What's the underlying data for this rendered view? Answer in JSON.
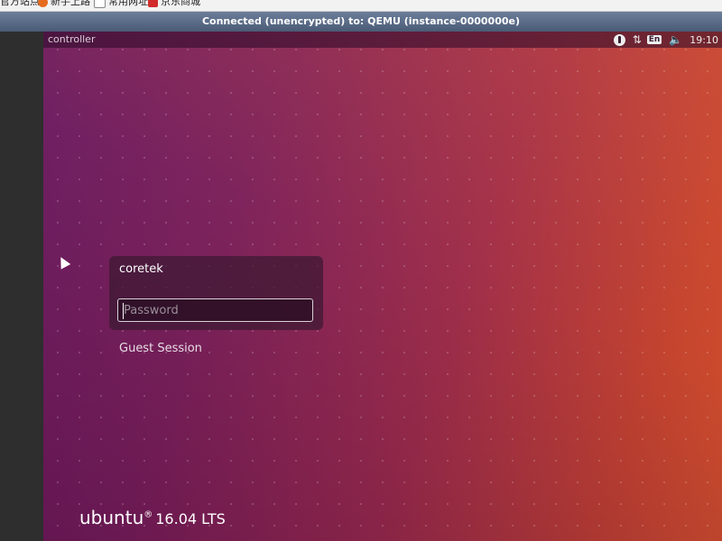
{
  "bookmarks": [
    {
      "label": "官方站点",
      "color": "#3b7bd4"
    },
    {
      "label": "新手上路",
      "color": "#e66b1f"
    },
    {
      "label": "常用网址",
      "color": "#888888"
    },
    {
      "label": "京东商城",
      "color": "#d22b2b"
    }
  ],
  "vnc": {
    "status": "Connected (unencrypted) to: QEMU (instance-0000000e)"
  },
  "panel": {
    "hostname": "controller",
    "keyboard": "En",
    "clock": "19:10"
  },
  "login": {
    "username": "coretek",
    "password_placeholder": "Password",
    "guest_label": "Guest Session"
  },
  "brand": {
    "name": "ubuntu",
    "mark": "®",
    "version": "16.04 LTS"
  },
  "colors": {
    "accent": "#c3432f",
    "purple": "#6d1f63"
  }
}
